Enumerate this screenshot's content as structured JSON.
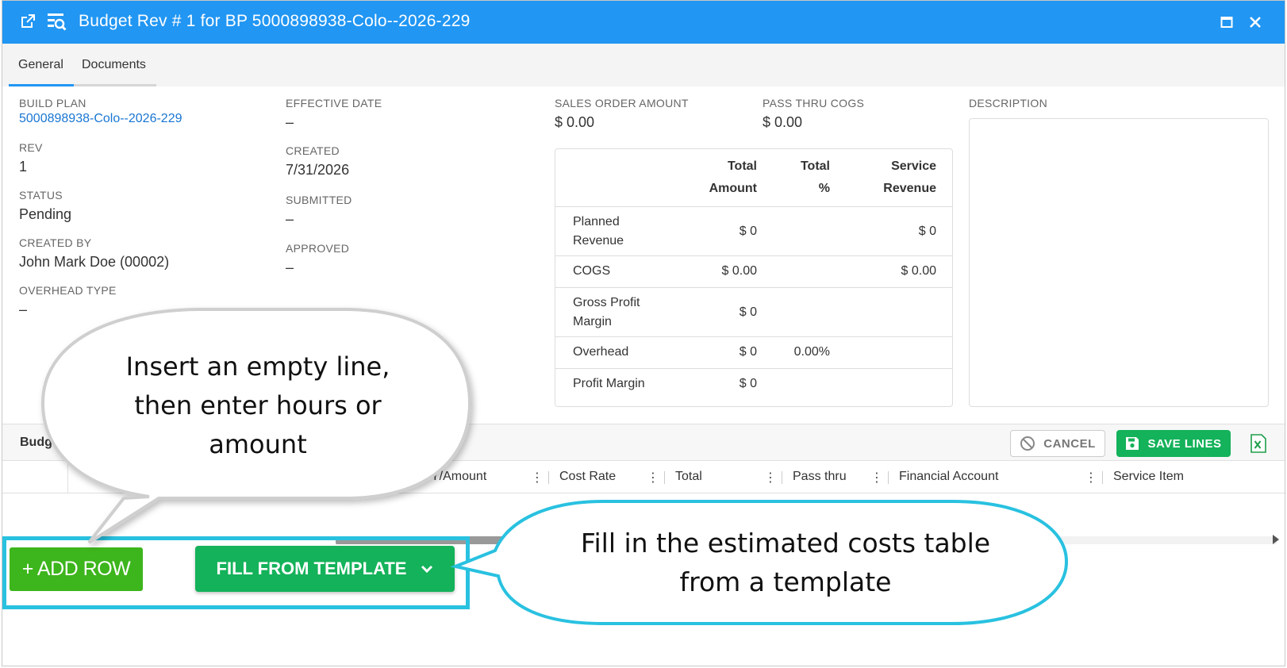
{
  "window": {
    "title": "Budget Rev # 1 for BP 5000898938-Colo--2026-229",
    "title_bar_color": "#2196f3",
    "icons": [
      "open-external-icon",
      "search-records-icon",
      "maximize-icon",
      "close-icon"
    ]
  },
  "tabs": [
    {
      "label": "General",
      "active": true
    },
    {
      "label": "Documents",
      "active": false
    }
  ],
  "fields": {
    "build_plan_label": "BUILD PLAN",
    "build_plan_value": "5000898938-Colo--2026-229",
    "rev_label": "REV",
    "rev_value": "1",
    "status_label": "STATUS",
    "status_value": "Pending",
    "created_by_label": "CREATED BY",
    "created_by_value": "John Mark Doe (00002)",
    "overhead_type_label": "OVERHEAD TYPE",
    "overhead_type_value": "–",
    "effective_date_label": "EFFECTIVE DATE",
    "effective_date_value": "–",
    "created_label": "CREATED",
    "created_value": "7/31/2026",
    "submitted_label": "SUBMITTED",
    "submitted_value": "–",
    "approved_label": "APPROVED",
    "approved_value": "–",
    "sales_order_amount_label": "SALES ORDER AMOUNT",
    "sales_order_amount_value": "$ 0.00",
    "pass_thru_cogs_label": "PASS THRU COGS",
    "pass_thru_cogs_value": "$ 0.00",
    "description_label": "DESCRIPTION"
  },
  "summary_table": {
    "headers": {
      "total_amount": [
        "Total",
        "Amount"
      ],
      "total_pct": [
        "Total",
        "%"
      ],
      "service_revenue": [
        "Service",
        "Revenue"
      ]
    },
    "rows": [
      {
        "label": [
          "Planned",
          "Revenue"
        ],
        "amount": "$ 0",
        "pct": "",
        "service": "$ 0"
      },
      {
        "label": [
          "COGS"
        ],
        "amount": "$ 0.00",
        "pct": "",
        "service": "$ 0.00"
      },
      {
        "label": [
          "Gross Profit",
          "Margin"
        ],
        "amount": "$ 0",
        "pct": "",
        "service": ""
      },
      {
        "label": [
          "Overhead"
        ],
        "amount": "$ 0",
        "pct": "0.00%",
        "service": ""
      },
      {
        "label": [
          "Profit Margin"
        ],
        "amount": "$ 0",
        "pct": "",
        "service": ""
      }
    ]
  },
  "lines_toolbar": {
    "title": "Budg",
    "cancel_label": "CANCEL",
    "save_label": "SAVE LINES",
    "export_icon": "excel-export-icon"
  },
  "grid_columns": [
    "Y/Amount",
    "Cost Rate",
    "Total",
    "Pass thru",
    "Financial Account",
    "Service Item"
  ],
  "actions": {
    "add_row_label": "+ ADD ROW",
    "fill_template_label": "FILL FROM TEMPLATE"
  },
  "callouts": {
    "left": [
      "Insert an empty line,",
      "then enter hours or",
      "amount"
    ],
    "right": [
      "Fill in the estimated costs table",
      "from a template"
    ]
  },
  "colors": {
    "accent_blue": "#2196f3",
    "save_green": "#14b25a",
    "add_green": "#3db51c",
    "highlight_cyan": "#29c1e0",
    "link_blue": "#1976d2"
  }
}
